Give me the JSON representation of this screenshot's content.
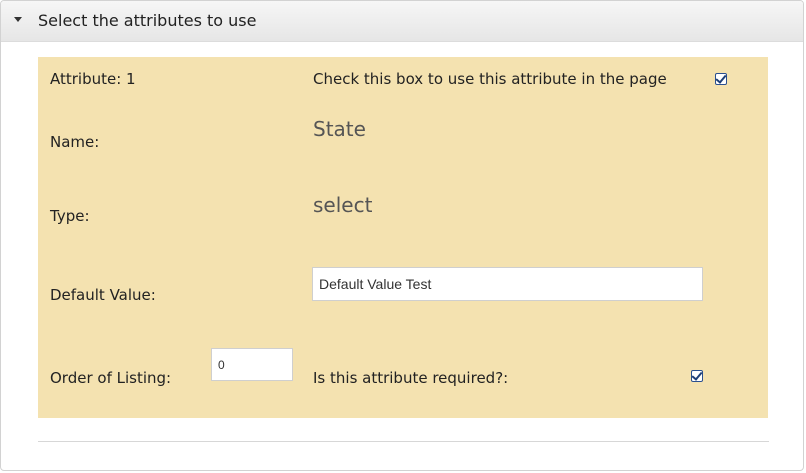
{
  "section": {
    "title": "Select the attributes to use"
  },
  "attribute": {
    "header_label": "Attribute: 1",
    "use_checkbox_label": "Check this box to use this attribute in the page",
    "use_checked": true,
    "name_label": "Name:",
    "name_value": "State",
    "type_label": "Type:",
    "type_value": "select",
    "default_value_label": "Default Value:",
    "default_value": "Default Value Test",
    "order_label": "Order of Listing:",
    "order_value": "0",
    "required_label": "Is this attribute required?:",
    "required_checked": true
  },
  "colors": {
    "attribute_bg": "#f4e2b0",
    "checkbox_border": "#2a4f8f"
  }
}
